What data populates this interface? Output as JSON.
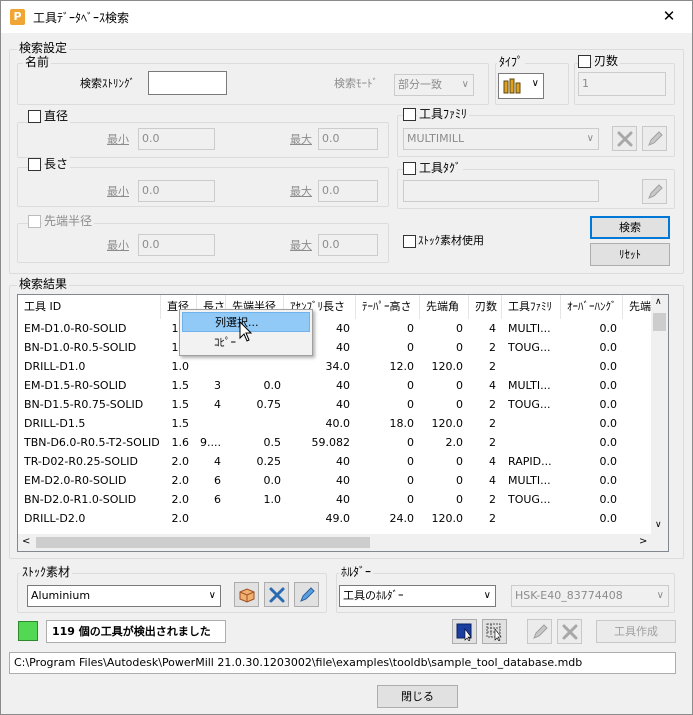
{
  "window": {
    "title": "工具ﾃﾞｰﾀﾍﾞｰｽ検索",
    "app_icon_letter": "P"
  },
  "search": {
    "group_title": "検索設定",
    "name_group": "名前",
    "string_label": "検索ｽﾄﾘﾝｸﾞ",
    "string_value": "",
    "mode_label": "検索ﾓｰﾄﾞ",
    "mode_value": "部分一致",
    "type_label": "ﾀｲﾌﾟ",
    "flutes_label": "刃数",
    "flutes_value": "1",
    "diameter_label": "直径",
    "length_label": "長さ",
    "tip_radius_label": "先端半径",
    "min_label": "最小",
    "max_label": "最大",
    "diameter_min": "0.0",
    "diameter_max": "0.0",
    "length_min": "0.0",
    "length_max": "0.0",
    "tip_min": "0.0",
    "tip_max": "0.0",
    "family_label": "工具ﾌｧﾐﾘ",
    "family_value": "MULTIMILL",
    "tag_label": "工具ﾀｸﾞ",
    "tag_value": "",
    "stock_use_label": "ｽﾄｯｸ素材使用",
    "search_button": "検索",
    "reset_button": "ﾘｾｯﾄ"
  },
  "results": {
    "group_title": "検索結果",
    "columns": [
      "工具 ID",
      "直径",
      "長さ",
      "先端半径",
      "ｱｾﾝﾌﾞﾘ長さ",
      "ﾃｰﾊﾟｰ高さ",
      "先端角",
      "刃数",
      "工具ﾌｧﾐﾘ",
      "ｵｰﾊﾞｰﾊﾝｸﾞ",
      "先端"
    ],
    "rows": [
      [
        "EM-D1.0-R0-SOLID",
        "1.0",
        "",
        "",
        "40",
        "0",
        "0",
        "4",
        "MULTI...",
        "0.0"
      ],
      [
        "BN-D1.0-R0.5-SOLID",
        "1.0",
        "",
        "",
        "40",
        "0",
        "0",
        "2",
        "TOUG...",
        "0.0"
      ],
      [
        "DRILL-D1.0",
        "1.0",
        "",
        "",
        "34.0",
        "12.0",
        "120.0",
        "2",
        "",
        "0.0"
      ],
      [
        "EM-D1.5-R0-SOLID",
        "1.5",
        "3",
        "0.0",
        "40",
        "0",
        "0",
        "4",
        "MULTI...",
        "0.0"
      ],
      [
        "BN-D1.5-R0.75-SOLID",
        "1.5",
        "4",
        "0.75",
        "40",
        "0",
        "0",
        "2",
        "TOUG...",
        "0.0"
      ],
      [
        "DRILL-D1.5",
        "1.5",
        "",
        "",
        "40.0",
        "18.0",
        "120.0",
        "2",
        "",
        "0.0"
      ],
      [
        "TBN-D6.0-R0.5-T2-SOLID",
        "1.6",
        "9....",
        "0.5",
        "59.082",
        "0",
        "2.0",
        "2",
        "",
        "0.0"
      ],
      [
        "TR-D02-R0.25-SOLID",
        "2.0",
        "4",
        "0.25",
        "40",
        "0",
        "0",
        "4",
        "RAPID...",
        "0.0"
      ],
      [
        "EM-D2.0-R0-SOLID",
        "2.0",
        "6",
        "0.0",
        "40",
        "0",
        "0",
        "4",
        "MULTI...",
        "0.0"
      ],
      [
        "BN-D2.0-R1.0-SOLID",
        "2.0",
        "6",
        "1.0",
        "40",
        "0",
        "0",
        "2",
        "TOUG...",
        "0.0"
      ],
      [
        "DRILL-D2.0",
        "2.0",
        "",
        "",
        "49.0",
        "24.0",
        "120.0",
        "2",
        "",
        "0.0"
      ]
    ],
    "context_menu": [
      "列選択...",
      "ｺﾋﾟｰ"
    ]
  },
  "stock": {
    "group_title": "ｽﾄｯｸ素材",
    "value": "Aluminium"
  },
  "holder": {
    "group_title": "ﾎﾙﾀﾞｰ",
    "value": "工具のﾎﾙﾀﾞｰ",
    "holder_id": "HSK-E40_83774408"
  },
  "status": {
    "text": "119 個の工具が検出されました",
    "create_tool_button": "工具作成"
  },
  "path": "C:\\Program Files\\Autodesk\\PowerMill 21.0.30.1203002\\file\\examples\\tooldb\\sample_tool_database.mdb",
  "close_button": "閉じる",
  "colors": {
    "accent": "#0078d7",
    "status_ok": "#53d853",
    "menu_highlight": "#91c9f7"
  }
}
